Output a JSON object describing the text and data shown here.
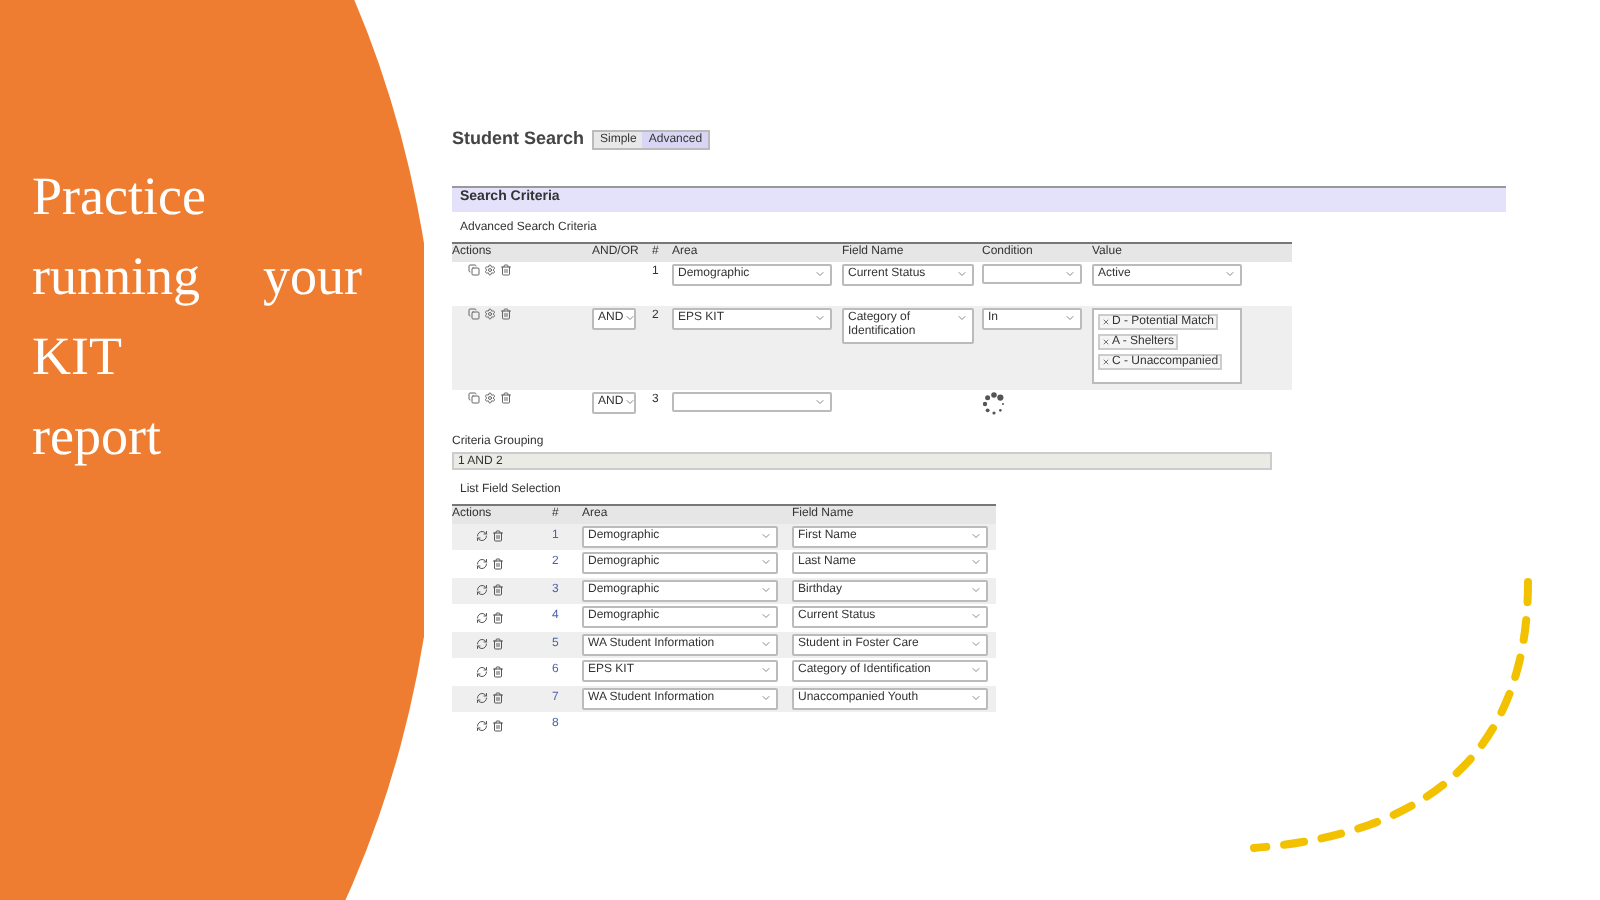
{
  "slide": {
    "title_lines": [
      "Practice",
      "running your",
      "KIT",
      "report"
    ]
  },
  "app": {
    "title": "Student Search",
    "modes": [
      {
        "label": "Simple",
        "selected": false
      },
      {
        "label": "Advanced",
        "selected": true
      }
    ],
    "section": "Search Criteria",
    "subsection": "Advanced Search Criteria",
    "columns": [
      "Actions",
      "AND/OR",
      "#",
      "Area",
      "Field Name",
      "Condition",
      "Value"
    ],
    "criteria": [
      {
        "number": "1",
        "area": "Demographic",
        "field": "Current Status",
        "kind": "select",
        "value": "Active"
      },
      {
        "andor": "AND",
        "number": "2",
        "area": "EPS KIT",
        "field": "Category of Identification",
        "condition": "In",
        "kind": "tags",
        "values": [
          "D - Potential Match",
          "A - Shelters",
          "C - Unaccompanied"
        ]
      },
      {
        "andor": "AND",
        "number": "3",
        "kind": "loading"
      }
    ],
    "grouping_label": "Criteria Grouping",
    "grouping_value": "1 AND 2",
    "list_section": "List Field Selection",
    "list_columns": [
      "Actions",
      "#",
      "Area",
      "Field Name"
    ],
    "list_rows": [
      {
        "number": "1",
        "area": "Demographic",
        "field": "First Name"
      },
      {
        "number": "2",
        "area": "Demographic",
        "field": "Last Name"
      },
      {
        "number": "3",
        "area": "Demographic",
        "field": "Birthday"
      },
      {
        "number": "4",
        "area": "Demographic",
        "field": "Current Status"
      },
      {
        "number": "5",
        "area": "WA Student Information",
        "field": "Student in Foster Care"
      },
      {
        "number": "6",
        "area": "EPS KIT",
        "field": "Category of Identification"
      },
      {
        "number": "7",
        "area": "WA Student Information",
        "field": "Unaccompanied Youth"
      },
      {
        "number": "8"
      }
    ]
  }
}
